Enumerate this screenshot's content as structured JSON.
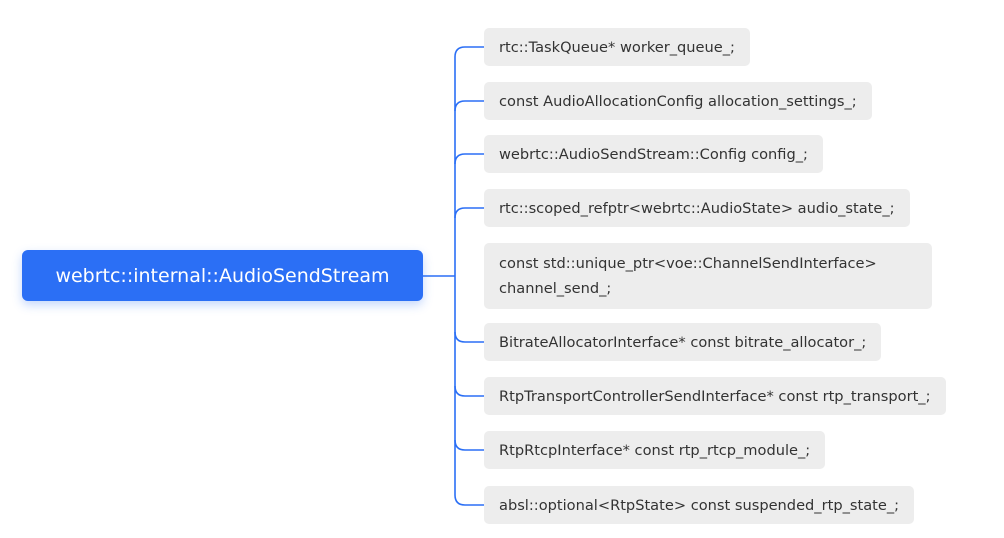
{
  "root": {
    "label": "webrtc::internal::AudioSendStream"
  },
  "members": [
    "rtc::TaskQueue* worker_queue_;",
    "const AudioAllocationConfig allocation_settings_;",
    "webrtc::AudioSendStream::Config config_;",
    "rtc::scoped_refptr<webrtc::AudioState> audio_state_;",
    "const std::unique_ptr<voe::ChannelSendInterface> channel_send_;",
    "BitrateAllocatorInterface* const bitrate_allocator_;",
    "RtpTransportControllerSendInterface* const rtp_transport_;",
    "RtpRtcpInterface* const rtp_rtcp_module_;",
    "absl::optional<RtpState> const suspended_rtp_state_;"
  ],
  "colors": {
    "root_fill": "#2b6ff5",
    "root_text": "#ffffff",
    "node_fill": "#ededed",
    "node_text": "#333333",
    "connector": "#2b6ff5"
  }
}
